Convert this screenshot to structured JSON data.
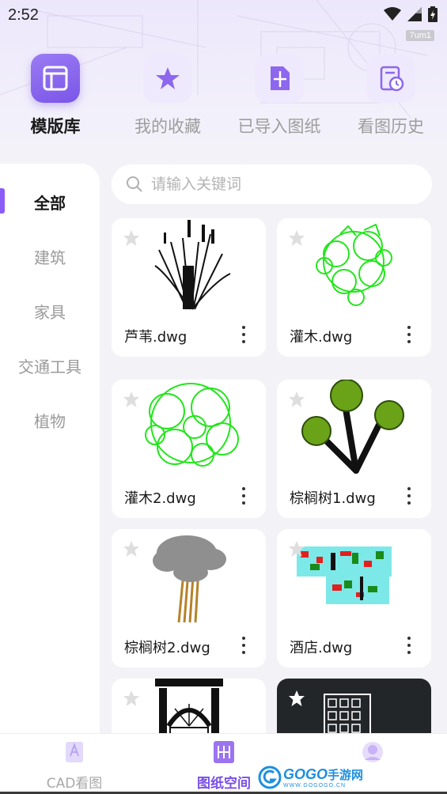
{
  "status_bar": {
    "time": "2:52",
    "badge": "7um1"
  },
  "top_nav": [
    {
      "label": "模版库",
      "icon": "template-library-icon",
      "active": true
    },
    {
      "label": "我的收藏",
      "icon": "star-favorites-icon",
      "active": false
    },
    {
      "label": "已导入图纸",
      "icon": "import-drawing-icon",
      "active": false
    },
    {
      "label": "看图历史",
      "icon": "history-icon",
      "active": false
    }
  ],
  "sidebar": {
    "items": [
      {
        "label": "全部",
        "active": true
      },
      {
        "label": "建筑",
        "active": false
      },
      {
        "label": "家具",
        "active": false
      },
      {
        "label": "交通工具",
        "active": false
      },
      {
        "label": "植物",
        "active": false
      }
    ]
  },
  "search": {
    "placeholder": "请输入关键词"
  },
  "cards": [
    {
      "name": "芦苇.dwg",
      "thumb": "reed"
    },
    {
      "name": "灌木.dwg",
      "thumb": "shrub"
    },
    {
      "name": "灌木2.dwg",
      "thumb": "shrub2"
    },
    {
      "name": "棕榈树1.dwg",
      "thumb": "palm1"
    },
    {
      "name": "棕榈树2.dwg",
      "thumb": "palm2"
    },
    {
      "name": "酒店.dwg",
      "thumb": "hotel"
    },
    {
      "name": "",
      "thumb": "arch"
    },
    {
      "name": "",
      "thumb": "building"
    }
  ],
  "bottom_tabs": [
    {
      "label": "CAD看图",
      "icon": "cad-view-icon",
      "active": false
    },
    {
      "label": "图纸空间",
      "icon": "drawing-space-icon",
      "active": true
    },
    {
      "label": "",
      "icon": "profile-avatar-icon",
      "active": false
    }
  ],
  "watermark": {
    "text_a": "GOGO",
    "text_b": "手游网",
    "sub": "WWW.GOGOGO.CN"
  },
  "colors": {
    "accent": "#7a4fe6",
    "indicator": "#8b5cf6",
    "shrub_green": "#22e61b",
    "palm_green": "#6aa318"
  }
}
